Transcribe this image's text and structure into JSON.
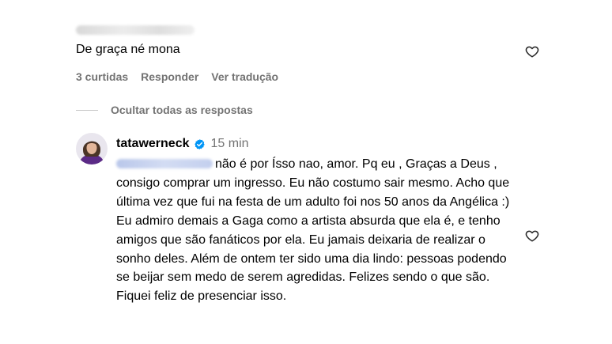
{
  "comment": {
    "text": "De graça né mona",
    "likes": "3 curtidas",
    "reply": "Responder",
    "translate": "Ver tradução",
    "like_icon": "heart-outline-icon"
  },
  "thread": {
    "hide_replies": "Ocultar todas as respostas"
  },
  "reply": {
    "username": "tatawerneck",
    "verified_icon": "verified-badge-icon",
    "time": "15 min",
    "text": "não é por Ísso nao, amor. Pq eu , Graças a Deus , consigo comprar um ingresso. Eu não costumo sair mesmo. Acho que última vez que fui na festa de um adulto foi nos 50 anos da Angélica :) Eu admiro demais a Gaga como a artista absurda que ela é, e tenho amigos que são fanáticos por ela. Eu jamais deixaria de realizar o sonho deles. Além de ontem ter sido uma dia lindo: pessoas podendo se beijar sem medo de serem agredidas. Felizes sendo o que são. Fiquei feliz de presenciar isso.",
    "like_icon": "heart-outline-icon"
  },
  "colors": {
    "secondary_text": "#737373",
    "verified_blue": "#0095f6",
    "mention_blue": "#00376b"
  }
}
